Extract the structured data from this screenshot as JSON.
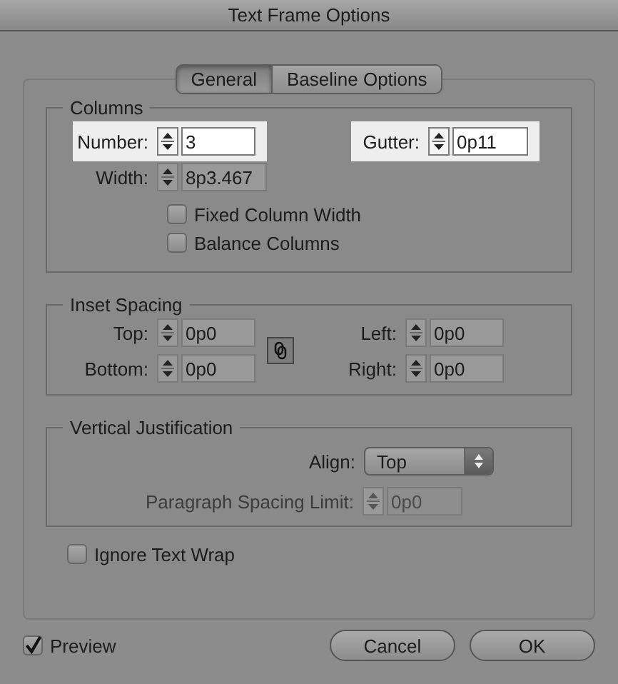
{
  "window": {
    "title": "Text Frame Options"
  },
  "tabs": [
    {
      "label": "General",
      "selected": true
    },
    {
      "label": "Baseline Options",
      "selected": false
    }
  ],
  "columns": {
    "title": "Columns",
    "number": {
      "label": "Number:",
      "value": "3",
      "highlighted": true
    },
    "gutter": {
      "label": "Gutter:",
      "value": "0p11",
      "highlighted": true
    },
    "width": {
      "label": "Width:",
      "value": "8p3.467",
      "highlighted": false
    },
    "checkboxes": [
      {
        "label": "Fixed Column Width",
        "checked": false
      },
      {
        "label": "Balance Columns",
        "checked": false
      }
    ]
  },
  "inset_spacing": {
    "title": "Inset Spacing",
    "left_fields": [
      {
        "label": "Top:",
        "value": "0p0"
      },
      {
        "label": "Bottom:",
        "value": "0p0"
      }
    ],
    "right_fields": [
      {
        "label": "Left:",
        "value": "0p0"
      },
      {
        "label": "Right:",
        "value": "0p0"
      }
    ]
  },
  "vertical_justification": {
    "title": "Vertical Justification",
    "align": {
      "label": "Align:",
      "value": "Top"
    },
    "paragraph_spacing_limit": {
      "label": "Paragraph Spacing Limit:",
      "value": "0p0",
      "disabled": true
    }
  },
  "ignore_text_wrap": {
    "label": "Ignore Text Wrap",
    "checked": false
  },
  "preview": {
    "label": "Preview",
    "checked": true
  },
  "buttons": [
    {
      "label": "Cancel"
    },
    {
      "label": "OK"
    }
  ]
}
